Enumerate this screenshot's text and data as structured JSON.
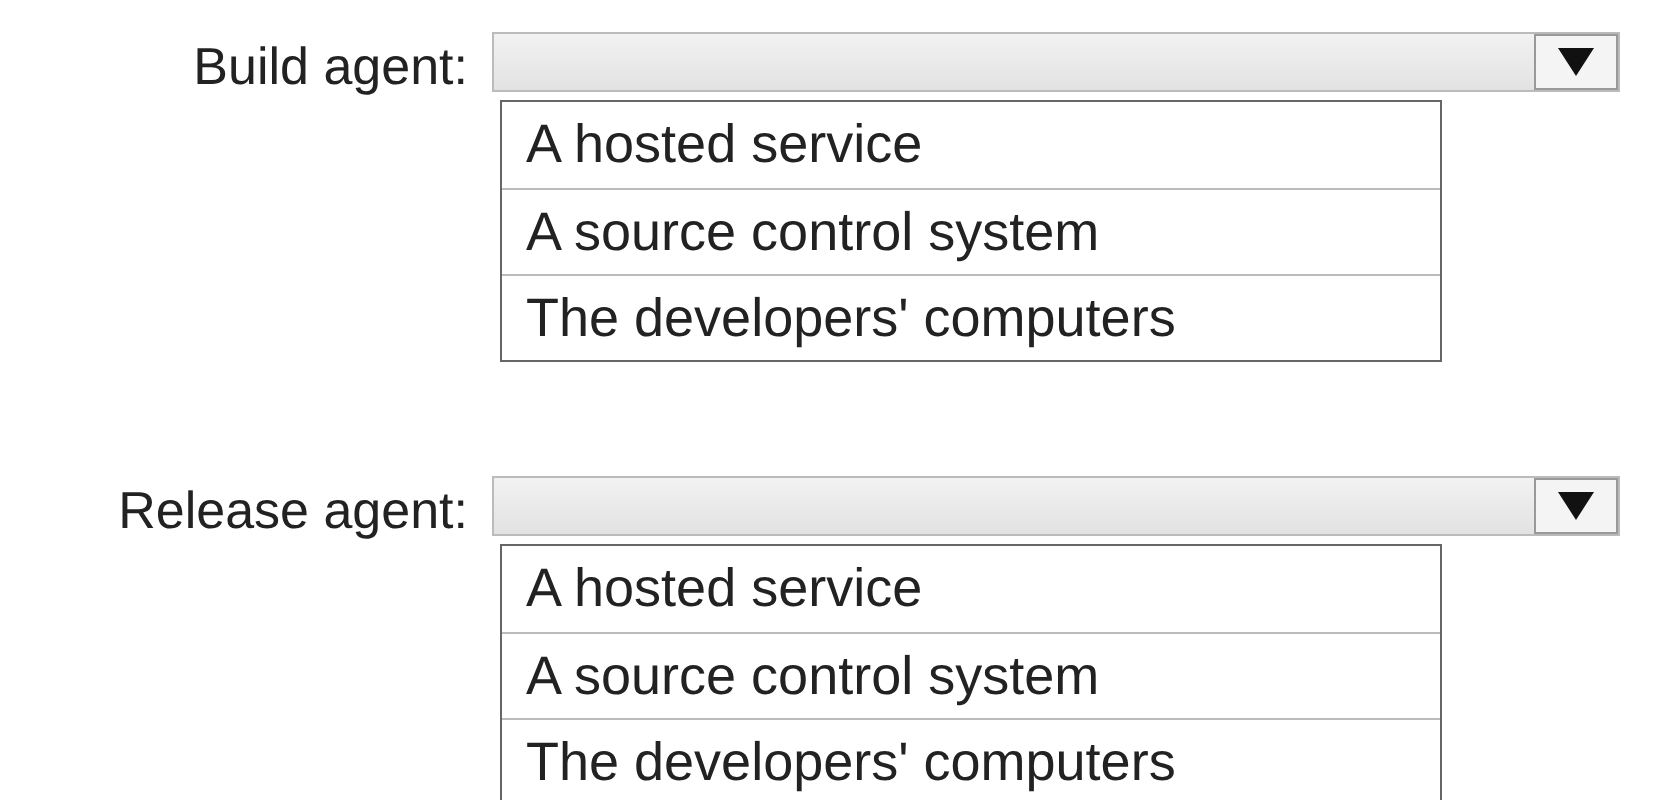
{
  "dropdowns": [
    {
      "label": "Build agent:",
      "options": [
        "A hosted service",
        "A source control system",
        "The developers' computers"
      ]
    },
    {
      "label": "Release agent:",
      "options": [
        "A hosted service",
        "A source control system",
        "The developers' computers"
      ]
    }
  ]
}
